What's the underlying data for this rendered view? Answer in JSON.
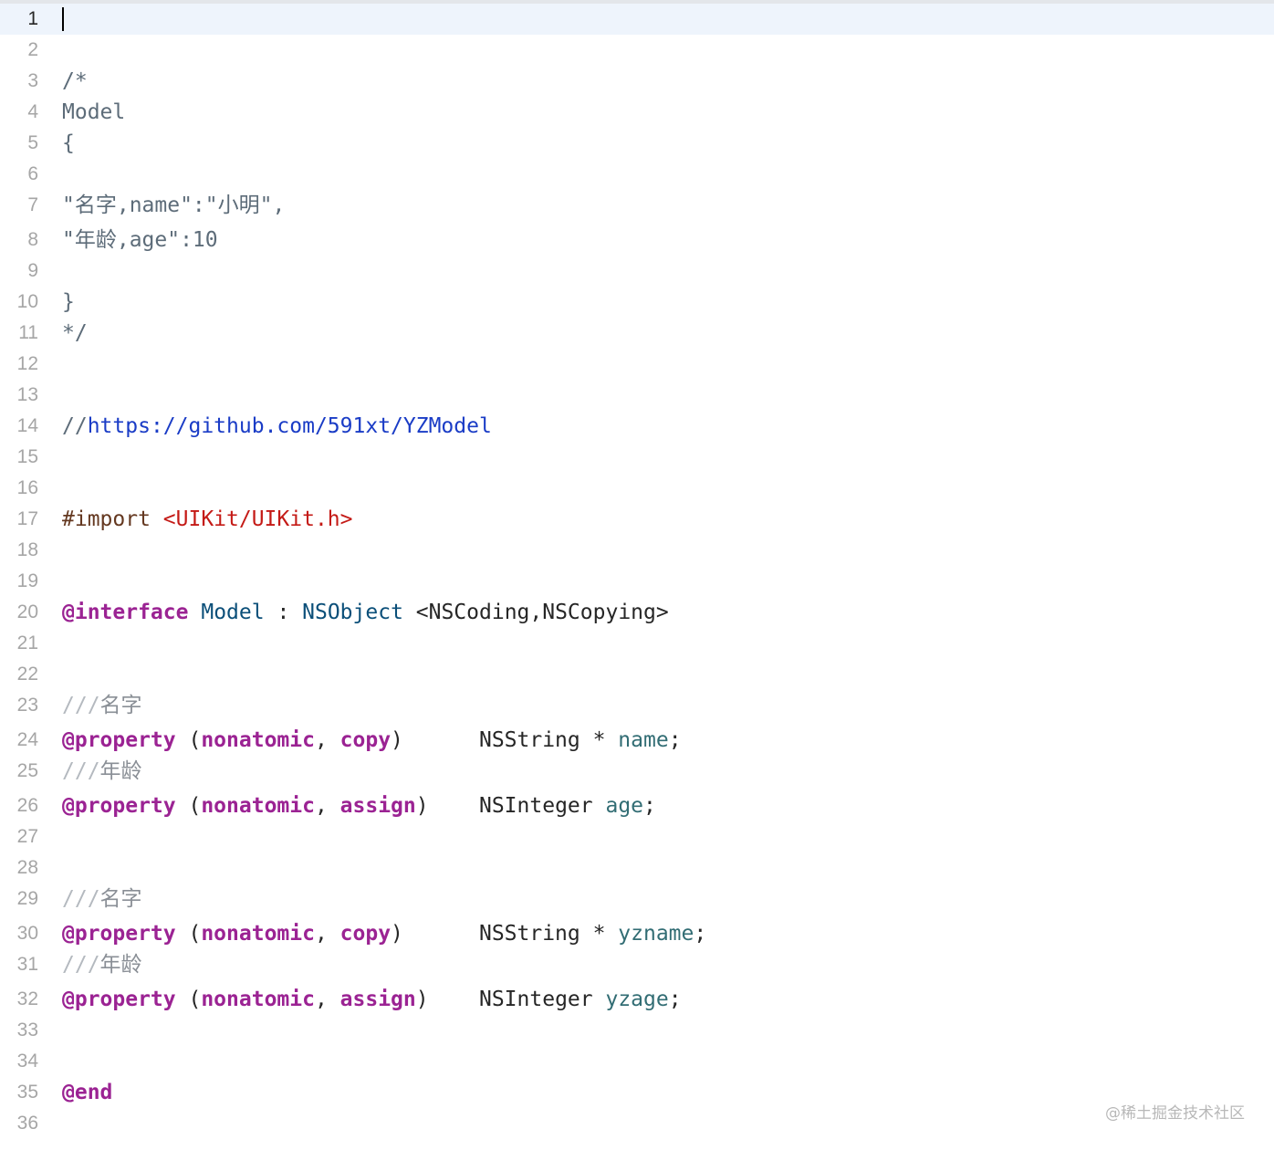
{
  "editor": {
    "current_line": 1,
    "lines": [
      {
        "n": "1",
        "tokens": []
      },
      {
        "n": "2",
        "tokens": []
      },
      {
        "n": "3",
        "tokens": [
          {
            "t": "/*",
            "c": "tok-comment"
          }
        ]
      },
      {
        "n": "4",
        "tokens": [
          {
            "t": "Model",
            "c": "tok-comment"
          }
        ]
      },
      {
        "n": "5",
        "tokens": [
          {
            "t": "{",
            "c": "tok-comment"
          }
        ]
      },
      {
        "n": "6",
        "tokens": []
      },
      {
        "n": "7",
        "tokens": [
          {
            "t": "\"名字,name\":\"小明\",",
            "c": "tok-comment"
          }
        ]
      },
      {
        "n": "8",
        "tokens": [
          {
            "t": "\"年龄,age\":10",
            "c": "tok-comment"
          }
        ]
      },
      {
        "n": "9",
        "tokens": []
      },
      {
        "n": "10",
        "tokens": [
          {
            "t": "}",
            "c": "tok-comment"
          }
        ]
      },
      {
        "n": "11",
        "tokens": [
          {
            "t": "*/",
            "c": "tok-comment"
          }
        ]
      },
      {
        "n": "12",
        "tokens": []
      },
      {
        "n": "13",
        "tokens": []
      },
      {
        "n": "14",
        "tokens": [
          {
            "t": "//",
            "c": "tok-comment"
          },
          {
            "t": "https://github.com/591xt/YZModel",
            "c": "tok-url"
          }
        ]
      },
      {
        "n": "15",
        "tokens": []
      },
      {
        "n": "16",
        "tokens": []
      },
      {
        "n": "17",
        "tokens": [
          {
            "t": "#import ",
            "c": "tok-directive"
          },
          {
            "t": "<UIKit/UIKit.h>",
            "c": "tok-header"
          }
        ]
      },
      {
        "n": "18",
        "tokens": []
      },
      {
        "n": "19",
        "tokens": []
      },
      {
        "n": "20",
        "tokens": [
          {
            "t": "@interface",
            "c": "tok-keyword"
          },
          {
            "t": " ",
            "c": "tok-plain"
          },
          {
            "t": "Model",
            "c": "tok-type"
          },
          {
            "t": " : ",
            "c": "tok-plain"
          },
          {
            "t": "NSObject",
            "c": "tok-type"
          },
          {
            "t": " <NSCoding,NSCopying>",
            "c": "tok-plain"
          }
        ]
      },
      {
        "n": "21",
        "tokens": []
      },
      {
        "n": "22",
        "tokens": []
      },
      {
        "n": "23",
        "tokens": [
          {
            "t": "///",
            "c": "tok-doc-slash"
          },
          {
            "t": "名字",
            "c": "tok-doc"
          }
        ]
      },
      {
        "n": "24",
        "tokens": [
          {
            "t": "@property",
            "c": "tok-keyword"
          },
          {
            "t": " (",
            "c": "tok-plain"
          },
          {
            "t": "nonatomic",
            "c": "tok-attr"
          },
          {
            "t": ", ",
            "c": "tok-plain"
          },
          {
            "t": "copy",
            "c": "tok-attr"
          },
          {
            "t": ")      NSString * ",
            "c": "tok-plain"
          },
          {
            "t": "name",
            "c": "tok-ident"
          },
          {
            "t": ";",
            "c": "tok-plain"
          }
        ]
      },
      {
        "n": "25",
        "tokens": [
          {
            "t": "///",
            "c": "tok-doc-slash"
          },
          {
            "t": "年龄",
            "c": "tok-doc"
          }
        ]
      },
      {
        "n": "26",
        "tokens": [
          {
            "t": "@property",
            "c": "tok-keyword"
          },
          {
            "t": " (",
            "c": "tok-plain"
          },
          {
            "t": "nonatomic",
            "c": "tok-attr"
          },
          {
            "t": ", ",
            "c": "tok-plain"
          },
          {
            "t": "assign",
            "c": "tok-attr"
          },
          {
            "t": ")    NSInteger ",
            "c": "tok-plain"
          },
          {
            "t": "age",
            "c": "tok-ident"
          },
          {
            "t": ";",
            "c": "tok-plain"
          }
        ]
      },
      {
        "n": "27",
        "tokens": []
      },
      {
        "n": "28",
        "tokens": []
      },
      {
        "n": "29",
        "tokens": [
          {
            "t": "///",
            "c": "tok-doc-slash"
          },
          {
            "t": "名字",
            "c": "tok-doc"
          }
        ]
      },
      {
        "n": "30",
        "tokens": [
          {
            "t": "@property",
            "c": "tok-keyword"
          },
          {
            "t": " (",
            "c": "tok-plain"
          },
          {
            "t": "nonatomic",
            "c": "tok-attr"
          },
          {
            "t": ", ",
            "c": "tok-plain"
          },
          {
            "t": "copy",
            "c": "tok-attr"
          },
          {
            "t": ")      NSString * ",
            "c": "tok-plain"
          },
          {
            "t": "yzname",
            "c": "tok-ident"
          },
          {
            "t": ";",
            "c": "tok-plain"
          }
        ]
      },
      {
        "n": "31",
        "tokens": [
          {
            "t": "///",
            "c": "tok-doc-slash"
          },
          {
            "t": "年龄",
            "c": "tok-doc"
          }
        ]
      },
      {
        "n": "32",
        "tokens": [
          {
            "t": "@property",
            "c": "tok-keyword"
          },
          {
            "t": " (",
            "c": "tok-plain"
          },
          {
            "t": "nonatomic",
            "c": "tok-attr"
          },
          {
            "t": ", ",
            "c": "tok-plain"
          },
          {
            "t": "assign",
            "c": "tok-attr"
          },
          {
            "t": ")    NSInteger ",
            "c": "tok-plain"
          },
          {
            "t": "yzage",
            "c": "tok-ident"
          },
          {
            "t": ";",
            "c": "tok-plain"
          }
        ]
      },
      {
        "n": "33",
        "tokens": []
      },
      {
        "n": "34",
        "tokens": []
      },
      {
        "n": "35",
        "tokens": [
          {
            "t": "@end",
            "c": "tok-keyword"
          }
        ]
      },
      {
        "n": "36",
        "tokens": []
      }
    ]
  },
  "watermark": "@稀土掘金技术社区"
}
